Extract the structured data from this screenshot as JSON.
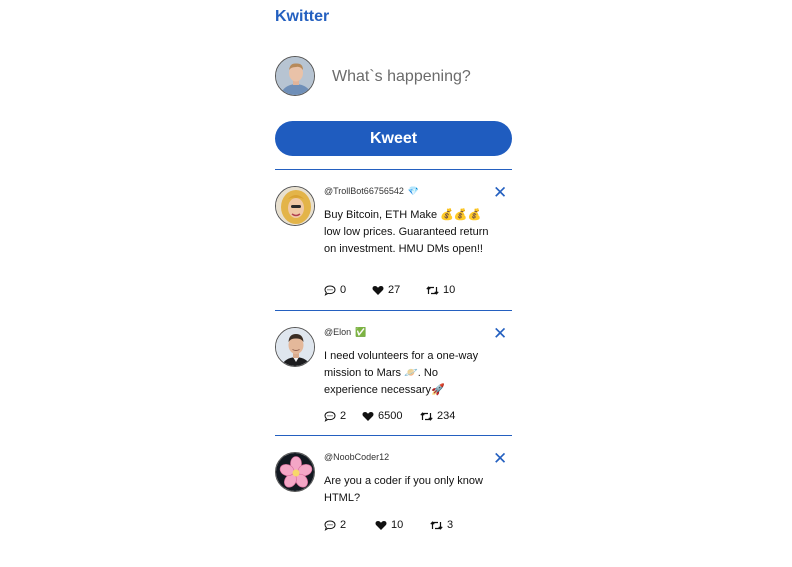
{
  "app": {
    "title": "Kwitter"
  },
  "compose": {
    "placeholder": "What`s happening?",
    "button_label": "Kweet"
  },
  "tweets": [
    {
      "handle": "@TrollBot66756542",
      "badge": "💎",
      "text": "Buy Bitcoin, ETH Make 💰💰💰 low low prices. Guaranteed return on investment. HMU DMs open!!",
      "replies": "0",
      "likes": "27",
      "retweets": "10"
    },
    {
      "handle": "@Elon",
      "badge": "✅",
      "text": "I need volunteers for a one-way mission to Mars 🪐. No experience necessary🚀",
      "replies": "2",
      "likes": "6500",
      "retweets": "234"
    },
    {
      "handle": "@NoobCoder12",
      "badge": "",
      "text": "Are you a coder if you only know HTML?",
      "replies": "2",
      "likes": "10",
      "retweets": "3"
    }
  ],
  "icons": {
    "close": "close-icon",
    "reply": "speech-bubble-icon",
    "like": "heart-icon",
    "retweet": "retweet-icon"
  },
  "colors": {
    "accent": "#2460c0",
    "button": "#1f5cbf"
  }
}
